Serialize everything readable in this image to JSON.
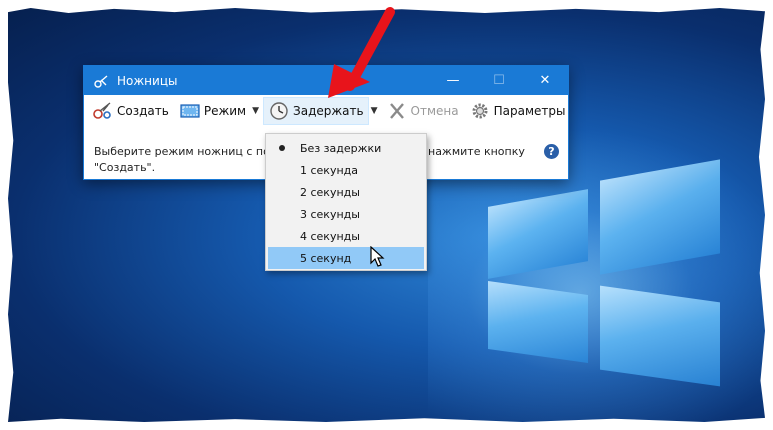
{
  "window": {
    "title": "Ножницы",
    "minimize": "—",
    "maximize": "☐",
    "close": "✕"
  },
  "toolbar": {
    "create_label": "Создать",
    "mode_label": "Режим",
    "delay_label": "Задержать",
    "cancel_label": "Отмена",
    "options_label": "Параметры"
  },
  "message": {
    "line1": "Выберите режим ножниц с пом",
    "line1_end": "нажмите кнопку",
    "line2": "\"Создать\"."
  },
  "help_label": "?",
  "delay_menu": {
    "items": [
      {
        "label": "Без задержки",
        "checked": true
      },
      {
        "label": "1 секунда"
      },
      {
        "label": "2 секунды"
      },
      {
        "label": "3 секунды"
      },
      {
        "label": "4 секунды"
      },
      {
        "label": "5 секунд",
        "hovered": true
      }
    ]
  },
  "colors": {
    "titlebar": "#1a7ad6",
    "menu_highlight": "#91c9f7",
    "annotation_arrow": "#e8141b"
  },
  "icons": {
    "app": "scissors-icon",
    "create": "scissors-icon",
    "mode": "rectangle-snip-icon",
    "delay": "clock-icon",
    "cancel": "x-icon",
    "options": "gear-icon"
  }
}
